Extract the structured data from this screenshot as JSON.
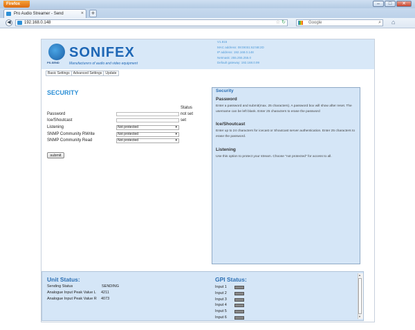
{
  "browser": {
    "menu_button": "Firefox",
    "tab_title": "Pro Audio Streamer - Send",
    "url": "192.168.0.148",
    "search_placeholder": "Google",
    "new_tab": "+"
  },
  "header": {
    "brand": "SONIFEX",
    "tagline": "Manufacturers of audio and video equipment",
    "logo_text": "PS-SEND",
    "info": [
      "V1.815",
      "MAC address: 08:08:B1:62:5B:2D",
      "IP address: 192.168.0.148",
      "Netmask: 255.255.255.0",
      "Default gateway: 192.168.0.99"
    ]
  },
  "page_tabs": [
    "Basic Settings",
    "Advanced Settings",
    "Update"
  ],
  "security": {
    "title": "SECURITY",
    "status_header": "Status",
    "password_label": "Password",
    "password_status": "not set",
    "ice_label": "Ice/Shoutcast",
    "ice_status": "set",
    "listening_label": "Listening",
    "listening_value": "Not protected",
    "snmp_write_label": "SNMP Community RWrite",
    "snmp_write_value": "Not protected",
    "snmp_read_label": "SNMP Community Read",
    "snmp_read_value": "Not protected",
    "submit": "submit"
  },
  "help": {
    "title": "Security",
    "password_head": "Password",
    "password_text": "Enter a password and submit(max. 25 characters). A password box will show after reset. The username can be left blank. Enter 25 characters to erase the password",
    "ice_head": "Ice/Shoutcast",
    "ice_text": "Enter up to 24 characters for icecast or Shoutcast server authentication. Enter 25 characters to erase the password.",
    "listening_head": "Listening",
    "listening_text": "Use this option to protect your stream. Choose \"not protected\" for access to all."
  },
  "unit_status": {
    "title": "Unit Status:",
    "sending_label": "Sending Status",
    "sending_value": "SENDING",
    "peak_l_label": "Analogue Input Peak Value L",
    "peak_l_value": "4211",
    "peak_r_label": "Analogue Input Peak Value R",
    "peak_r_value": "4073"
  },
  "gpi_status": {
    "title": "GPI Status:",
    "inputs": [
      "Input 1",
      "Input 2",
      "Input 3",
      "Input 4",
      "Input 5",
      "Input 6"
    ]
  }
}
